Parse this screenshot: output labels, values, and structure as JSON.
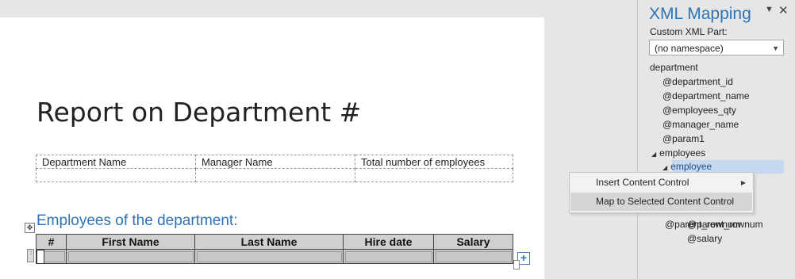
{
  "document": {
    "title": "Report on Department #",
    "summary_table": {
      "headers": [
        "Department Name",
        "Manager Name",
        "Total number of employees"
      ]
    },
    "section_heading": "Employees of the department:",
    "employees_table": {
      "headers": [
        "#",
        "First Name",
        "Last Name",
        "Hire date",
        "Salary"
      ]
    }
  },
  "pane": {
    "title": "XML Mapping",
    "options_icon": "chevron-down-icon",
    "close_icon": "close-icon",
    "custom_part_label": "Custom XML Part:",
    "custom_part_value": "(no namespace)",
    "tree": {
      "root": "department",
      "attributes": [
        "@department_id",
        "@department_name",
        "@employees_qty",
        "@manager_name",
        "@param1"
      ],
      "employees": "employees",
      "employee": "employee",
      "employee_children_partial": "@...",
      "employee_children": [
        "@parent_rownum",
        "@salary"
      ]
    }
  },
  "context_menu": {
    "items": [
      {
        "label": "Insert Content Control",
        "has_submenu": true,
        "hotkey": "I"
      },
      {
        "label": "Map to Selected Content Control",
        "has_submenu": false,
        "hotkey": "M"
      }
    ]
  },
  "colors": {
    "accent": "#2e74b5",
    "selection": "#c5d9f1"
  }
}
